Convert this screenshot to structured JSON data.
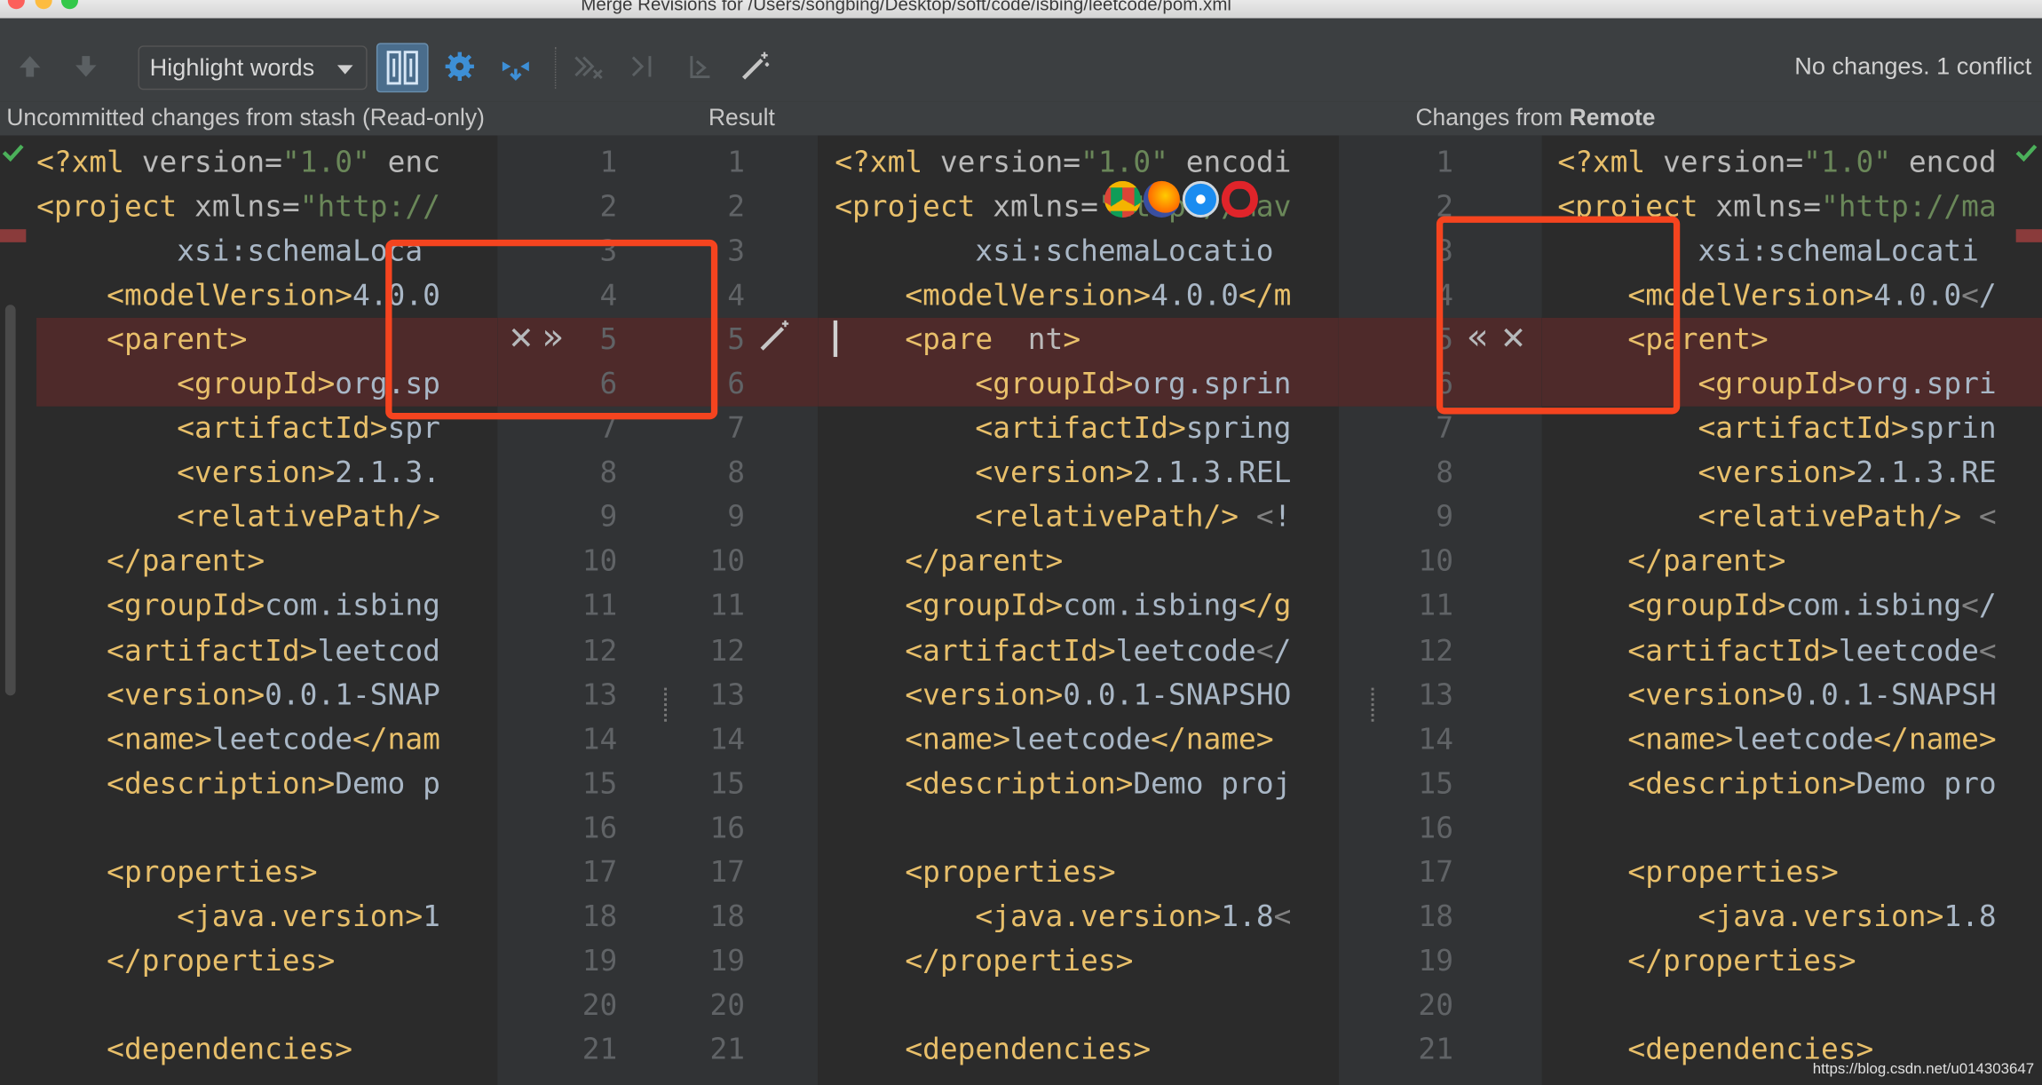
{
  "window": {
    "title": "Merge Revisions for /Users/songbing/Desktop/soft/code/isbing/leetcode/pom.xml"
  },
  "toolbar": {
    "highlight_combo": "Highlight words",
    "status": "No changes. 1 conflict"
  },
  "headers": {
    "left": "Uncommitted changes from stash (Read-only)",
    "center": "Result",
    "right_prefix": "Changes from ",
    "right_bold": "Remote"
  },
  "line_numbers": [
    "1",
    "2",
    "3",
    "4",
    "5",
    "6",
    "7",
    "8",
    "9",
    "10",
    "11",
    "12",
    "13",
    "14",
    "15",
    "16",
    "17",
    "18",
    "19",
    "20",
    "21"
  ],
  "left_code": [
    "<?xml version=\"1.0\" enc",
    "<project xmlns=\"http://",
    "        xsi:schemaLoca",
    "    <modelVersion>4.0.0",
    "    <parent>",
    "        <groupId>org.sp",
    "        <artifactId>spr",
    "        <version>2.1.3.",
    "        <relativePath/>",
    "    </parent>",
    "    <groupId>com.isbing",
    "    <artifactId>leetcod",
    "    <version>0.0.1-SNAP",
    "    <name>leetcode</nam",
    "    <description>Demo p",
    "",
    "    <properties>",
    "        <java.version>1",
    "    </properties>",
    "",
    "    <dependencies>"
  ],
  "center_code": [
    "<?xml version=\"1.0\" encodi",
    "<project xmlns=\"http://mav",
    "        xsi:schemaLocatio",
    "    <modelVersion>4.0.0</m",
    "    <pare  nt>",
    "        <groupId>org.sprin",
    "        <artifactId>spring",
    "        <version>2.1.3.REL",
    "        <relativePath/> <!",
    "    </parent>",
    "    <groupId>com.isbing</g",
    "    <artifactId>leetcode</",
    "    <version>0.0.1-SNAPSHO",
    "    <name>leetcode</name>",
    "    <description>Demo proj",
    "",
    "    <properties>",
    "        <java.version>1.8<",
    "    </properties>",
    "",
    "    <dependencies>"
  ],
  "right_code": [
    "<?xml version=\"1.0\" encod",
    "<project xmlns=\"http://ma",
    "        xsi:schemaLocati",
    "    <modelVersion>4.0.0</",
    "    <parent>",
    "        <groupId>org.spri",
    "        <artifactId>sprin",
    "        <version>2.1.3.RE",
    "        <relativePath/> <",
    "    </parent>",
    "    <groupId>com.isbing</",
    "    <artifactId>leetcode<",
    "    <version>0.0.1-SNAPSH",
    "    <name>leetcode</name>",
    "    <description>Demo pro",
    "",
    "    <properties>",
    "        <java.version>1.8",
    "    </properties>",
    "",
    "    <dependencies>"
  ],
  "controls": {
    "left_reject": "✕",
    "left_accept": "»",
    "right_accept": "«",
    "right_reject": "✕"
  },
  "watermark": "https://blog.csdn.net/u014303647",
  "colors": {
    "tag": "#e8bf6a",
    "value": "#6a8759",
    "conflict_bg": "#4e2a2a",
    "annotation_box": "#f5441f"
  }
}
